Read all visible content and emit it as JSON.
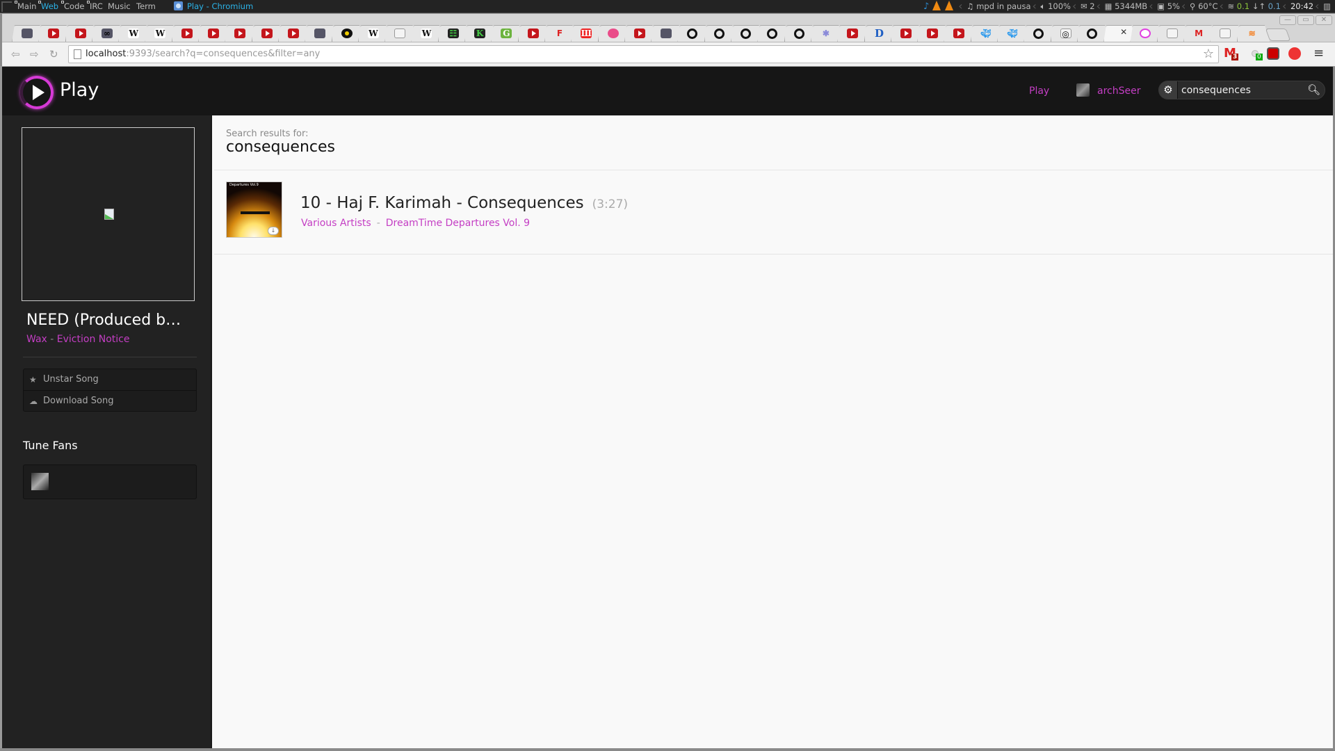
{
  "system_panel": {
    "workspaces": [
      {
        "label": "Main",
        "active": false
      },
      {
        "label": "Web",
        "active": true
      },
      {
        "label": "Code",
        "active": false
      },
      {
        "label": "IRC",
        "active": false
      },
      {
        "label": "Music",
        "active": false
      },
      {
        "label": "Term",
        "active": false
      }
    ],
    "window_title": "Play - Chromium",
    "status": {
      "mpd": "mpd in pausa",
      "volume": "100%",
      "mail": "2",
      "memory": "5344MB",
      "cpu": "5%",
      "temperature": "60°C",
      "net_down": "0.1",
      "net_up": "0.1",
      "clock": "20:42"
    }
  },
  "browser": {
    "tabs": [
      {
        "icon": "photo-favicon"
      },
      {
        "icon": "youtube-icon"
      },
      {
        "icon": "youtube-icon"
      },
      {
        "icon": "infinity-favicon"
      },
      {
        "icon": "wikipedia-icon"
      },
      {
        "icon": "wikipedia-icon"
      },
      {
        "icon": "youtube-icon"
      },
      {
        "icon": "youtube-icon"
      },
      {
        "icon": "youtube-icon"
      },
      {
        "icon": "youtube-icon"
      },
      {
        "icon": "youtube-icon"
      },
      {
        "icon": "photo-favicon"
      },
      {
        "icon": "vinyl-icon"
      },
      {
        "icon": "wikipedia-icon"
      },
      {
        "icon": "document-icon"
      },
      {
        "icon": "wikipedia-icon"
      },
      {
        "icon": "dark-app-icon"
      },
      {
        "icon": "k-icon"
      },
      {
        "icon": "g-icon"
      },
      {
        "icon": "youtube-icon"
      },
      {
        "icon": "fw-icon"
      },
      {
        "icon": "red-app-icon"
      },
      {
        "icon": "dribbble-icon"
      },
      {
        "icon": "youtube-icon"
      },
      {
        "icon": "photo-favicon"
      },
      {
        "icon": "github-icon"
      },
      {
        "icon": "github-icon"
      },
      {
        "icon": "github-icon"
      },
      {
        "icon": "github-icon"
      },
      {
        "icon": "github-icon"
      },
      {
        "icon": "bug-icon"
      },
      {
        "icon": "youtube-icon"
      },
      {
        "icon": "d-icon"
      },
      {
        "icon": "youtube-icon"
      },
      {
        "icon": "youtube-icon"
      },
      {
        "icon": "youtube-icon"
      },
      {
        "icon": "docker-icon"
      },
      {
        "icon": "docker-icon"
      },
      {
        "icon": "github-icon"
      },
      {
        "icon": "headphones-icon"
      },
      {
        "icon": "github-icon"
      },
      {
        "icon": "active-close",
        "active": true
      },
      {
        "icon": "play-favicon"
      },
      {
        "icon": "document-icon"
      },
      {
        "icon": "gmail-icon"
      },
      {
        "icon": "document-icon"
      },
      {
        "icon": "stackoverflow-icon"
      }
    ],
    "url_host": "localhost",
    "url_rest": ":9393/search?q=consequences&filter=any",
    "extensions": {
      "gmail_count": "3",
      "medal_count": "0"
    }
  },
  "app": {
    "brand": "Play",
    "nav": {
      "play_link": "Play",
      "username": "archSeer"
    },
    "search": {
      "value": "consequences",
      "placeholder": ""
    },
    "sidebar": {
      "now_playing_title": "NEED (Produced b…",
      "now_playing_artist": "Wax",
      "now_playing_separator": "-",
      "now_playing_album": "Eviction Notice",
      "actions": [
        {
          "label": "Unstar Song",
          "icon": "star-icon"
        },
        {
          "label": "Download Song",
          "icon": "cloud-download-icon"
        }
      ],
      "fans_title": "Tune Fans"
    },
    "main": {
      "results_label": "Search results for:",
      "query": "consequences",
      "results": [
        {
          "title": "10 - Haj F. Karimah - Consequences",
          "duration": "(3:27)",
          "artist": "Various Artists",
          "separator": "-",
          "album": "DreamTime Departures Vol. 9",
          "cover_caption": "Departures Vol.9"
        }
      ]
    }
  }
}
